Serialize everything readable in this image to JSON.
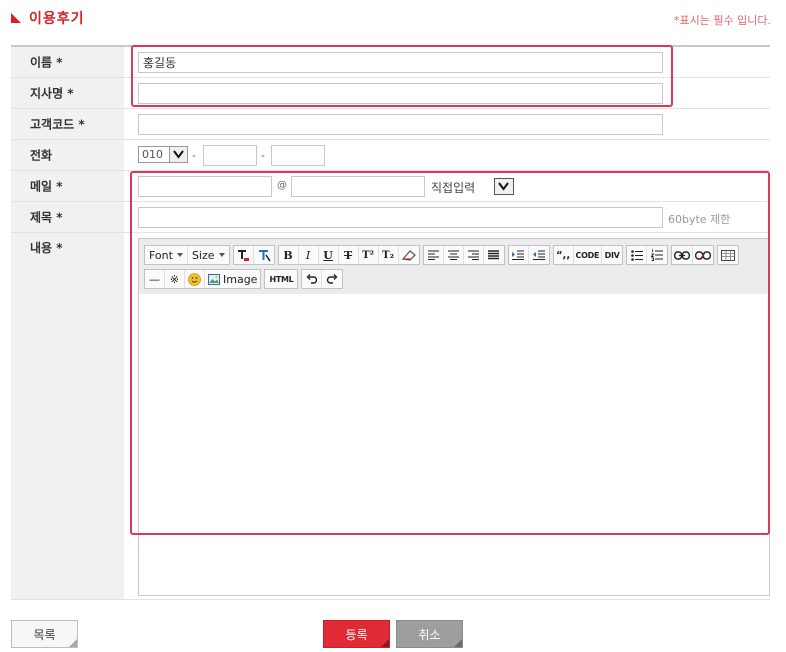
{
  "header": {
    "title": "이용후기",
    "required_note": "*표시는 필수 입니다."
  },
  "form": {
    "name": {
      "label": "이름 *",
      "value": "홍길동"
    },
    "branch": {
      "label": "지사명 *",
      "value": ""
    },
    "customer_code": {
      "label": "고객코드 *",
      "value": ""
    },
    "phone": {
      "label": "전화",
      "prefix": "010",
      "dash": "-",
      "middle": "",
      "last": ""
    },
    "email": {
      "label": "메일 *",
      "local": "",
      "at": "@",
      "domain": "",
      "domain_select": "직접입력"
    },
    "subject": {
      "label": "제목 *",
      "value": "",
      "hint": "60byte 제한"
    },
    "content": {
      "label": "내용 *"
    }
  },
  "editor": {
    "font_label": "Font",
    "size_label": "Size",
    "bold": "B",
    "italic": "I",
    "underline": "U",
    "strike": "T",
    "superscript": "T²",
    "subscript": "T₂",
    "quote": "“,,",
    "code": "CODE",
    "div": "DIV",
    "hr": "—",
    "special_char": "※",
    "image": "Image",
    "html": "HTML"
  },
  "buttons": {
    "list": "목록",
    "submit": "등록",
    "cancel": "취소"
  },
  "colors": {
    "accent": "#d2232a",
    "highlight": "#d83a57",
    "submit_bg": "#e02a35",
    "cancel_bg": "#9e9e9e"
  }
}
